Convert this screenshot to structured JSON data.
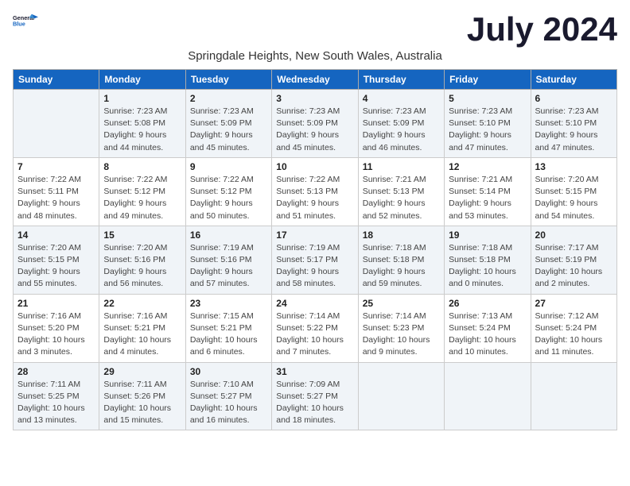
{
  "logo": {
    "general": "General",
    "blue": "Blue"
  },
  "title": {
    "month_year": "July 2024",
    "location": "Springdale Heights, New South Wales, Australia"
  },
  "days_of_week": [
    "Sunday",
    "Monday",
    "Tuesday",
    "Wednesday",
    "Thursday",
    "Friday",
    "Saturday"
  ],
  "weeks": [
    [
      {
        "day": "",
        "info": ""
      },
      {
        "day": "1",
        "info": "Sunrise: 7:23 AM\nSunset: 5:08 PM\nDaylight: 9 hours\nand 44 minutes."
      },
      {
        "day": "2",
        "info": "Sunrise: 7:23 AM\nSunset: 5:09 PM\nDaylight: 9 hours\nand 45 minutes."
      },
      {
        "day": "3",
        "info": "Sunrise: 7:23 AM\nSunset: 5:09 PM\nDaylight: 9 hours\nand 45 minutes."
      },
      {
        "day": "4",
        "info": "Sunrise: 7:23 AM\nSunset: 5:09 PM\nDaylight: 9 hours\nand 46 minutes."
      },
      {
        "day": "5",
        "info": "Sunrise: 7:23 AM\nSunset: 5:10 PM\nDaylight: 9 hours\nand 47 minutes."
      },
      {
        "day": "6",
        "info": "Sunrise: 7:23 AM\nSunset: 5:10 PM\nDaylight: 9 hours\nand 47 minutes."
      }
    ],
    [
      {
        "day": "7",
        "info": "Sunrise: 7:22 AM\nSunset: 5:11 PM\nDaylight: 9 hours\nand 48 minutes."
      },
      {
        "day": "8",
        "info": "Sunrise: 7:22 AM\nSunset: 5:12 PM\nDaylight: 9 hours\nand 49 minutes."
      },
      {
        "day": "9",
        "info": "Sunrise: 7:22 AM\nSunset: 5:12 PM\nDaylight: 9 hours\nand 50 minutes."
      },
      {
        "day": "10",
        "info": "Sunrise: 7:22 AM\nSunset: 5:13 PM\nDaylight: 9 hours\nand 51 minutes."
      },
      {
        "day": "11",
        "info": "Sunrise: 7:21 AM\nSunset: 5:13 PM\nDaylight: 9 hours\nand 52 minutes."
      },
      {
        "day": "12",
        "info": "Sunrise: 7:21 AM\nSunset: 5:14 PM\nDaylight: 9 hours\nand 53 minutes."
      },
      {
        "day": "13",
        "info": "Sunrise: 7:20 AM\nSunset: 5:15 PM\nDaylight: 9 hours\nand 54 minutes."
      }
    ],
    [
      {
        "day": "14",
        "info": "Sunrise: 7:20 AM\nSunset: 5:15 PM\nDaylight: 9 hours\nand 55 minutes."
      },
      {
        "day": "15",
        "info": "Sunrise: 7:20 AM\nSunset: 5:16 PM\nDaylight: 9 hours\nand 56 minutes."
      },
      {
        "day": "16",
        "info": "Sunrise: 7:19 AM\nSunset: 5:16 PM\nDaylight: 9 hours\nand 57 minutes."
      },
      {
        "day": "17",
        "info": "Sunrise: 7:19 AM\nSunset: 5:17 PM\nDaylight: 9 hours\nand 58 minutes."
      },
      {
        "day": "18",
        "info": "Sunrise: 7:18 AM\nSunset: 5:18 PM\nDaylight: 9 hours\nand 59 minutes."
      },
      {
        "day": "19",
        "info": "Sunrise: 7:18 AM\nSunset: 5:18 PM\nDaylight: 10 hours\nand 0 minutes."
      },
      {
        "day": "20",
        "info": "Sunrise: 7:17 AM\nSunset: 5:19 PM\nDaylight: 10 hours\nand 2 minutes."
      }
    ],
    [
      {
        "day": "21",
        "info": "Sunrise: 7:16 AM\nSunset: 5:20 PM\nDaylight: 10 hours\nand 3 minutes."
      },
      {
        "day": "22",
        "info": "Sunrise: 7:16 AM\nSunset: 5:21 PM\nDaylight: 10 hours\nand 4 minutes."
      },
      {
        "day": "23",
        "info": "Sunrise: 7:15 AM\nSunset: 5:21 PM\nDaylight: 10 hours\nand 6 minutes."
      },
      {
        "day": "24",
        "info": "Sunrise: 7:14 AM\nSunset: 5:22 PM\nDaylight: 10 hours\nand 7 minutes."
      },
      {
        "day": "25",
        "info": "Sunrise: 7:14 AM\nSunset: 5:23 PM\nDaylight: 10 hours\nand 9 minutes."
      },
      {
        "day": "26",
        "info": "Sunrise: 7:13 AM\nSunset: 5:24 PM\nDaylight: 10 hours\nand 10 minutes."
      },
      {
        "day": "27",
        "info": "Sunrise: 7:12 AM\nSunset: 5:24 PM\nDaylight: 10 hours\nand 11 minutes."
      }
    ],
    [
      {
        "day": "28",
        "info": "Sunrise: 7:11 AM\nSunset: 5:25 PM\nDaylight: 10 hours\nand 13 minutes."
      },
      {
        "day": "29",
        "info": "Sunrise: 7:11 AM\nSunset: 5:26 PM\nDaylight: 10 hours\nand 15 minutes."
      },
      {
        "day": "30",
        "info": "Sunrise: 7:10 AM\nSunset: 5:27 PM\nDaylight: 10 hours\nand 16 minutes."
      },
      {
        "day": "31",
        "info": "Sunrise: 7:09 AM\nSunset: 5:27 PM\nDaylight: 10 hours\nand 18 minutes."
      },
      {
        "day": "",
        "info": ""
      },
      {
        "day": "",
        "info": ""
      },
      {
        "day": "",
        "info": ""
      }
    ]
  ]
}
